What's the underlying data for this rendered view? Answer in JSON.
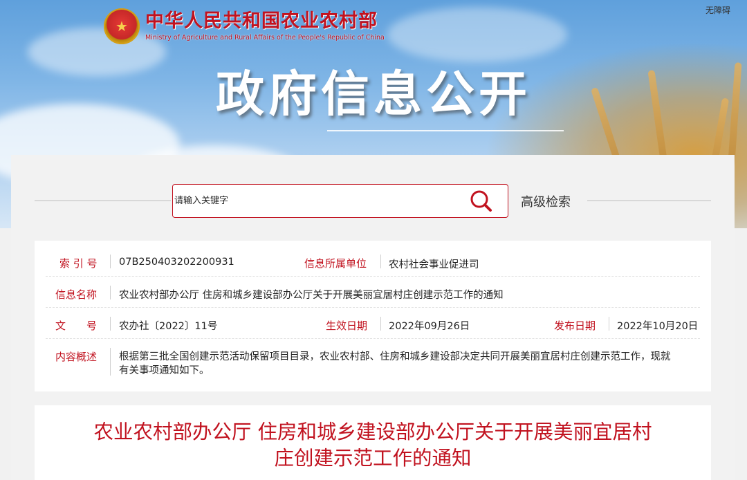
{
  "header": {
    "accessibility": "无障碍",
    "ministry_cn": "中华人民共和国农业农村部",
    "ministry_en": "Ministry of Agriculture and Rural Affairs of the People's Republic of China",
    "page_title": "政府信息公开",
    "emblem_icon": "national-emblem-icon"
  },
  "search": {
    "placeholder": "请输入关键字",
    "button_icon": "search-icon",
    "advanced_label": "高级检索"
  },
  "info": {
    "index_label": "索 引 号",
    "index_value": "07B250403202200931",
    "unit_label": "信息所属单位",
    "unit_value": "农村社会事业促进司",
    "name_label": "信息名称",
    "name_value": "农业农村部办公厅 住房和城乡建设部办公厅关于开展美丽宜居村庄创建示范工作的通知",
    "doc_label": "文　　号",
    "doc_value": "农办社〔2022〕11号",
    "effective_label": "生效日期",
    "effective_value": "2022年09月26日",
    "publish_label": "发布日期",
    "publish_value": "2022年10月20日",
    "summary_label": "内容概述",
    "summary_line1": "根据第三批全国创建示范活动保留项目目录，农业农村部、住房和城乡建设部决定共同开展美丽宜居村庄创建示范工作，现就",
    "summary_line2": "有关事项通知如下。"
  },
  "article": {
    "title_line1": "农业农村部办公厅 住房和城乡建设部办公厅关于开展美丽宜居村",
    "title_line2": "庄创建示范工作的通知"
  },
  "colors": {
    "accent_red": "#c1121f",
    "sky_blue": "#7fb5e6",
    "wheat_gold": "#d69c3c"
  }
}
